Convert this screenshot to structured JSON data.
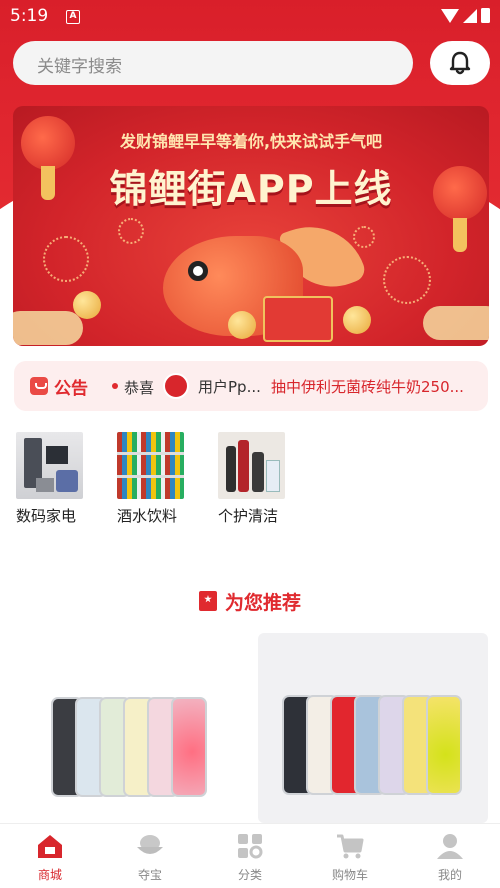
{
  "status_bar": {
    "time": "5:19",
    "notification_letter": "A"
  },
  "search": {
    "placeholder": "关键字搜索"
  },
  "banner": {
    "subtitle": "发财锦鲤早早等着你,快来试试手气吧",
    "title": "锦鲤街APP上线"
  },
  "notice": {
    "label": "公告",
    "congrats": "恭喜",
    "user": "用户Pp...",
    "prize": "抽中伊利无菌砖纯牛奶250..."
  },
  "categories": [
    {
      "label": "数码家电",
      "icon": "appliances-image"
    },
    {
      "label": "酒水饮料",
      "icon": "beverages-image"
    },
    {
      "label": "个护清洁",
      "icon": "personal-care-image"
    }
  ],
  "recommend": {
    "title": "为您推荐"
  },
  "products": [
    {
      "image": "iphone-15-lineup"
    },
    {
      "image": "iphone-14-lineup"
    }
  ],
  "bottom_nav": [
    {
      "label": "商城",
      "icon": "home-icon",
      "active": true
    },
    {
      "label": "夺宝",
      "icon": "treasure-icon",
      "active": false
    },
    {
      "label": "分类",
      "icon": "category-icon",
      "active": false
    },
    {
      "label": "购物车",
      "icon": "cart-icon",
      "active": false
    },
    {
      "label": "我的",
      "icon": "user-icon",
      "active": false
    }
  ],
  "colors": {
    "brand_red": "#e02a2f",
    "header_red": "#d91f2a",
    "notice_bg": "#fdeeee"
  }
}
